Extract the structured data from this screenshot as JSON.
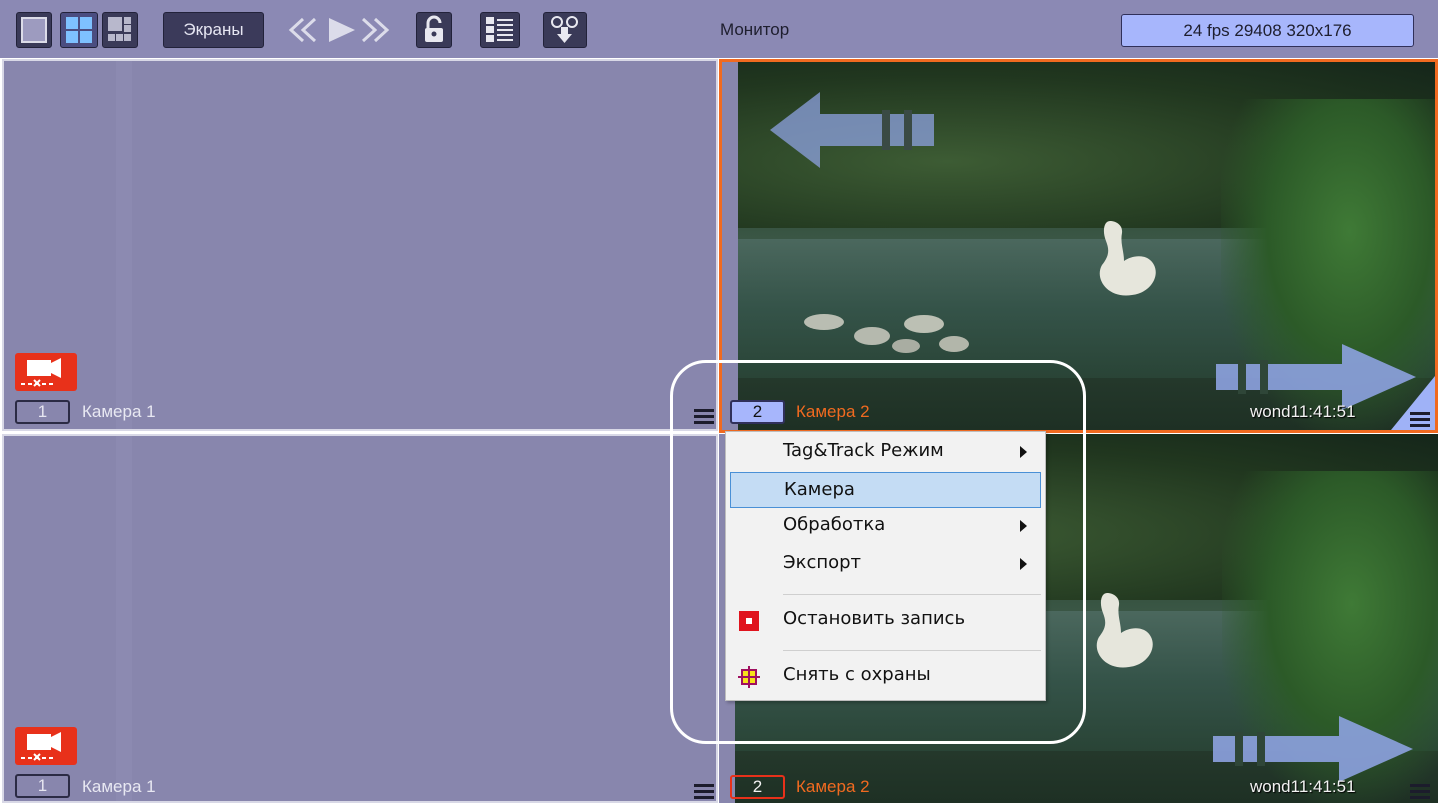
{
  "toolbar": {
    "screens_label": "Экраны",
    "monitor_label": "Монитор",
    "fps_readout": "24 fps  29408 320x176",
    "icons": [
      "layout-single-icon",
      "layout-2x2-icon",
      "layout-3x3-icon",
      "rewind-icon",
      "play-icon",
      "fast-forward-icon",
      "lock-icon",
      "list-icon",
      "export-icon"
    ]
  },
  "cells": {
    "top_left": {
      "num": "1",
      "label": "Камера 1"
    },
    "bottom_left": {
      "num": "1",
      "label": "Камера 1"
    },
    "top_right": {
      "num": "2",
      "label": "Камера 2",
      "timestamp": "wond11:41:51"
    },
    "bottom_right": {
      "num": "2",
      "label": "Камера 2",
      "timestamp": "wond11:41:51"
    }
  },
  "context_menu": {
    "items": [
      {
        "label": "Tag&Track Режим",
        "submenu": true
      },
      {
        "label": "Камера",
        "highlighted": true
      },
      {
        "label": "Обработка",
        "submenu": true
      },
      {
        "label": "Экспорт",
        "submenu": true
      },
      {
        "label": "Остановить запись",
        "icon": "stop-record-icon"
      },
      {
        "label": "Снять с охраны",
        "icon": "disarm-icon"
      }
    ]
  },
  "colors": {
    "accent_orange": "#f06a20",
    "selected_blue": "#a7b6fc",
    "panel": "#8886ad",
    "record_red": "#e8311a"
  }
}
